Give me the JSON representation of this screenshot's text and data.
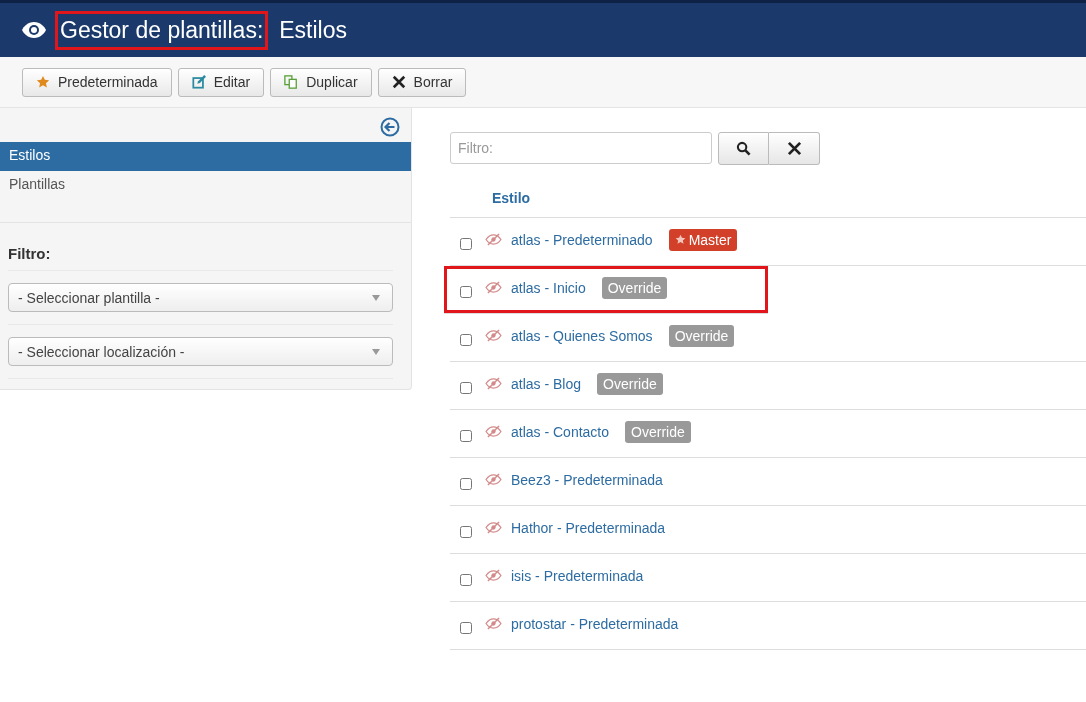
{
  "header": {
    "title_parts": [
      {
        "text": "Gestor de plantillas:",
        "highlighted": true
      },
      {
        "text": "Estilos",
        "highlighted": false
      }
    ]
  },
  "toolbar": [
    {
      "label": "Predeterminada",
      "kind": "star"
    },
    {
      "label": "Editar",
      "kind": "edit"
    },
    {
      "label": "Duplicar",
      "kind": "copy"
    },
    {
      "label": "Borrar",
      "kind": "delete"
    }
  ],
  "sidebar": {
    "items": [
      {
        "label": "Estilos",
        "selected": true
      },
      {
        "label": "Plantillas",
        "selected": false
      }
    ],
    "filter_title": "Filtro:",
    "selects": [
      {
        "value": "- Seleccionar plantilla -"
      },
      {
        "value": "- Seleccionar localización -"
      }
    ]
  },
  "search": {
    "placeholder": "Filtro:"
  },
  "table": {
    "column": "Estilo",
    "rows": [
      {
        "name": "atlas - Predeterminado",
        "checked": false,
        "highlighted": false,
        "badge": {
          "kind": "master",
          "text": "Master"
        }
      },
      {
        "name": "atlas - Inicio",
        "checked": false,
        "highlighted": true,
        "badge": {
          "kind": "override",
          "text": "Override"
        }
      },
      {
        "name": "atlas - Quienes Somos",
        "checked": false,
        "highlighted": false,
        "badge": {
          "kind": "override",
          "text": "Override"
        }
      },
      {
        "name": "atlas - Blog",
        "checked": false,
        "highlighted": false,
        "badge": {
          "kind": "override",
          "text": "Override"
        }
      },
      {
        "name": "atlas - Contacto",
        "checked": false,
        "highlighted": false,
        "badge": {
          "kind": "override",
          "text": "Override"
        }
      },
      {
        "name": "Beez3 - Predeterminada",
        "checked": false,
        "highlighted": false
      },
      {
        "name": "Hathor - Predeterminada",
        "checked": false,
        "highlighted": false
      },
      {
        "name": "isis - Predeterminada",
        "checked": false,
        "highlighted": false
      },
      {
        "name": "protostar - Predeterminada",
        "checked": false,
        "highlighted": false
      }
    ]
  }
}
